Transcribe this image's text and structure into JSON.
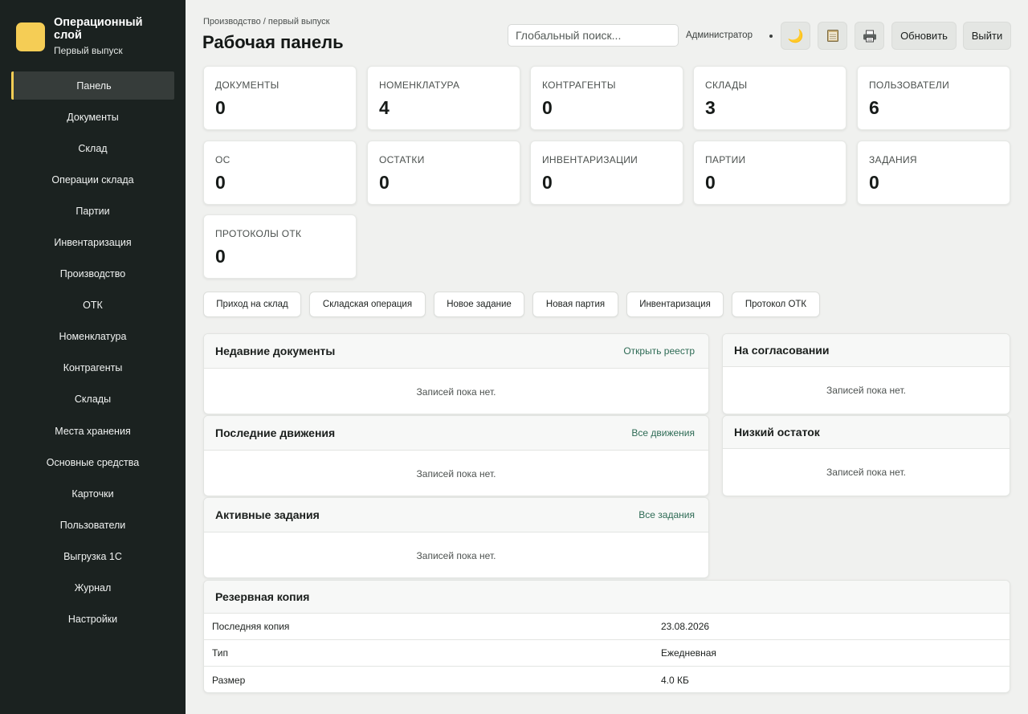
{
  "app": {
    "title": "Операционный слой",
    "subtitle": "Первый выпуск"
  },
  "sidebar": {
    "items": [
      {
        "label": "Панель"
      },
      {
        "label": "Документы"
      },
      {
        "label": "Склад"
      },
      {
        "label": "Операции склада"
      },
      {
        "label": "Партии"
      },
      {
        "label": "Инвентаризация"
      },
      {
        "label": "Производство"
      },
      {
        "label": "ОТК"
      },
      {
        "label": "Номенклатура"
      },
      {
        "label": "Контрагенты"
      },
      {
        "label": "Склады"
      },
      {
        "label": "Места хранения"
      },
      {
        "label": "Основные средства"
      },
      {
        "label": "Карточки"
      },
      {
        "label": "Пользователи"
      },
      {
        "label": "Выгрузка 1С"
      },
      {
        "label": "Журнал"
      },
      {
        "label": "Настройки"
      }
    ],
    "active_index": 0
  },
  "header": {
    "breadcrumb": "Производство / первый выпуск",
    "title": "Рабочая панель",
    "search_placeholder": "Глобальный поиск...",
    "user_role": "Администратор",
    "refresh_label": "Обновить",
    "logout_label": "Выйти",
    "icons": [
      "moon-icon",
      "notepad-icon",
      "printer-icon"
    ]
  },
  "stats": [
    {
      "label": "Документы",
      "value": "0"
    },
    {
      "label": "Номенклатура",
      "value": "4"
    },
    {
      "label": "Контрагенты",
      "value": "0"
    },
    {
      "label": "Склады",
      "value": "3"
    },
    {
      "label": "Пользователи",
      "value": "6"
    },
    {
      "label": "ОС",
      "value": "0"
    },
    {
      "label": "Остатки",
      "value": "0"
    },
    {
      "label": "Инвентаризации",
      "value": "0"
    },
    {
      "label": "Партии",
      "value": "0"
    },
    {
      "label": "Задания",
      "value": "0"
    },
    {
      "label": "Протоколы ОТК",
      "value": "0"
    }
  ],
  "quick_actions": [
    {
      "label": "Приход на склад"
    },
    {
      "label": "Складская операция"
    },
    {
      "label": "Новое задание"
    },
    {
      "label": "Новая партия"
    },
    {
      "label": "Инвентаризация"
    },
    {
      "label": "Протокол ОТК"
    }
  ],
  "panels": {
    "recent_docs": {
      "title": "Недавние документы",
      "link": "Открыть реестр",
      "empty": "Записей пока нет."
    },
    "movements": {
      "title": "Последние движения",
      "link": "Все движения",
      "empty": "Записей пока нет."
    },
    "tasks": {
      "title": "Активные задания",
      "link": "Все задания",
      "empty": "Записей пока нет."
    },
    "approval": {
      "title": "На согласовании",
      "empty": "Записей пока нет."
    },
    "low_stock": {
      "title": "Низкий остаток",
      "empty": "Записей пока нет."
    }
  },
  "backup": {
    "title": "Резервная копия",
    "rows": [
      {
        "key": "Последняя копия",
        "value": "23.08.2026"
      },
      {
        "key": "Тип",
        "value": "Ежедневная"
      },
      {
        "key": "Размер",
        "value": "4.0 КБ"
      }
    ]
  },
  "colors": {
    "sidebar_bg": "#1b2220",
    "accent": "#f5cd55",
    "link": "#2e6b55",
    "page_bg": "#f0f1ef"
  }
}
